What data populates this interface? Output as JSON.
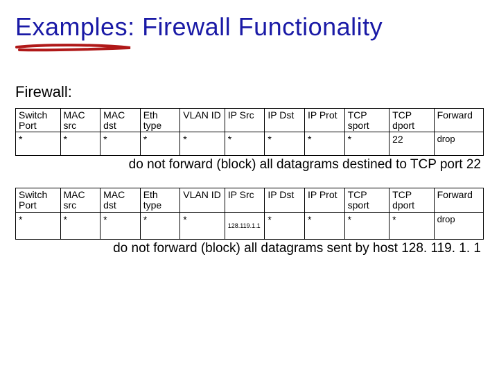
{
  "title": "Examples: Firewall Functionality",
  "section": "Firewall:",
  "headers": {
    "switch_port": "Switch Port",
    "mac_src": "MAC src",
    "mac_dst": "MAC dst",
    "eth_type": "Eth type",
    "vlan_id": "VLAN ID",
    "ip_src": "IP Src",
    "ip_dst": "IP Dst",
    "ip_prot": "IP Prot",
    "tcp_sport": "TCP sport",
    "tcp_dport": "TCP dport",
    "forward": "Forward"
  },
  "rule1": {
    "switch_port": "*",
    "mac_src": "*",
    "mac_dst": "*",
    "eth_type": "*",
    "vlan_id": "*",
    "ip_src": "*",
    "ip_dst": "*",
    "ip_prot": "*",
    "tcp_sport": "*",
    "tcp_dport": "22",
    "action": "drop",
    "caption": "do not forward (block) all datagrams destined to TCP port 22"
  },
  "rule2": {
    "switch_port": "*",
    "mac_src": "*",
    "mac_dst": "*",
    "eth_type": "*",
    "vlan_id": "*",
    "ip_src": "128.119.1.1",
    "ip_dst": "*",
    "ip_prot": "*",
    "tcp_sport": "*",
    "tcp_dport": "*",
    "action": "drop",
    "caption": "do not forward (block) all datagrams sent by host 128. 119. 1. 1"
  }
}
